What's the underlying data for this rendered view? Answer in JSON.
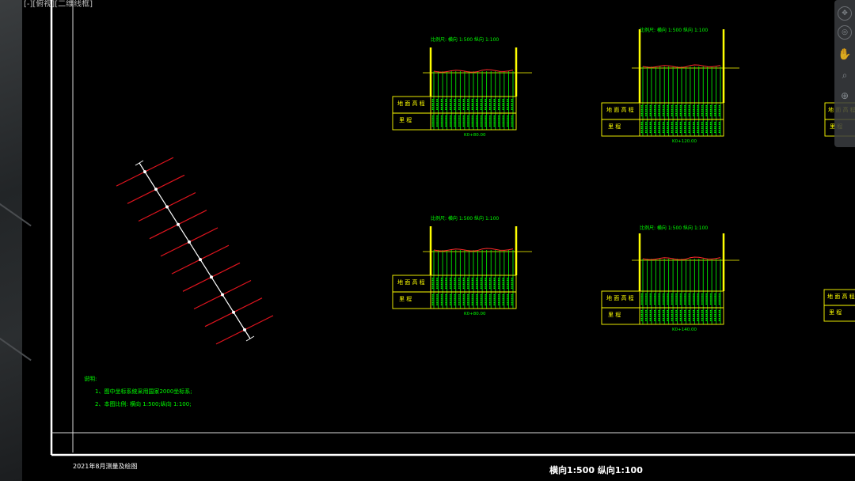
{
  "viewport_label": "[-][俯视][二维线框]",
  "sections": [
    {
      "scale_note": "比例尺:  横向 1:500   纵向 1:100",
      "ground_label": "地 面 高 程",
      "mileage_label": "里    程",
      "station": "K0+80.00"
    },
    {
      "scale_note": "比例尺:  横向 1:500   纵向 1:100",
      "ground_label": "地 面 高 程",
      "mileage_label": "里    程",
      "station": "K0+120.00"
    },
    {
      "scale_note": "比例尺:  横向 1:500   纵向 1:100",
      "ground_label": "地 面 高 程",
      "mileage_label": "里    程",
      "station": "K0+80.00"
    },
    {
      "scale_note": "比例尺:  横向 1:500   纵向 1:100",
      "ground_label": "地 面 高 程",
      "mileage_label": "里    程",
      "station": "K0+140.00"
    }
  ],
  "partial_sections": [
    {
      "ground_label": "地 面 高 程",
      "mileage_label": "里    程"
    },
    {
      "ground_label": "地 面 高 程",
      "mileage_label": "里    程"
    }
  ],
  "notes": {
    "heading": "说明:",
    "line1": "1、图中坐标系统采用国家2000坐标系;",
    "line2": "2、本图比例: 横向 1:500;纵向 1:100;"
  },
  "footer": {
    "date_text": "2021年8月测量及绘图",
    "scale_text": "横向1:500 纵向1:100"
  },
  "nav_icons": [
    "pan-icon",
    "orbit-icon",
    "hand-icon",
    "zoom-icon",
    "steering-wheel-icon"
  ],
  "colors": {
    "frame": "#ffffff",
    "section_green": "#00ff00",
    "table_yellow": "#ffff00",
    "ground_red": "#ff2a2a",
    "plan_red": "#e0141e"
  }
}
